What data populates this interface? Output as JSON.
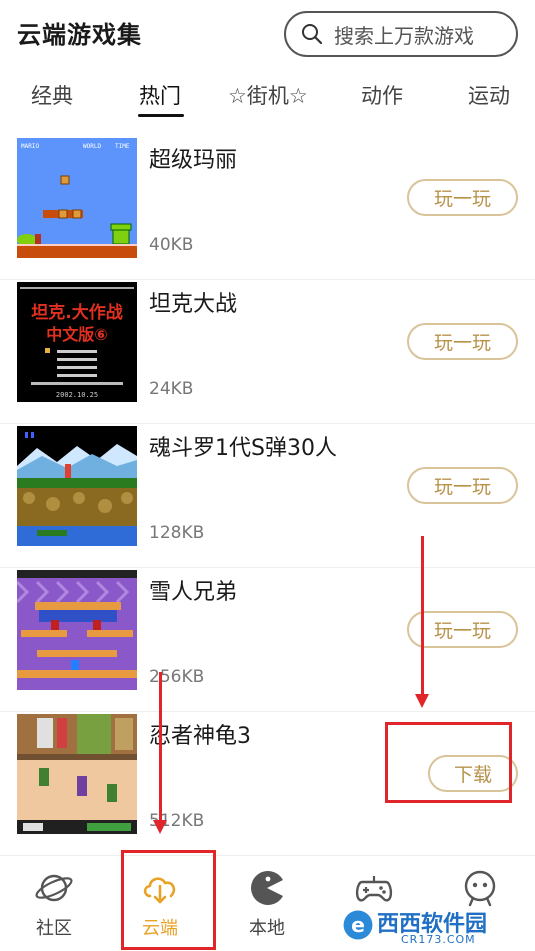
{
  "header": {
    "title": "云端游戏集",
    "search_placeholder": "搜索上万款游戏"
  },
  "tabs": [
    {
      "label": "经典",
      "active": false
    },
    {
      "label": "热门",
      "active": true
    },
    {
      "label": "☆街机☆",
      "active": false
    },
    {
      "label": "动作",
      "active": false
    },
    {
      "label": "运动",
      "active": false
    }
  ],
  "games": [
    {
      "name": "超级玛丽",
      "size": "40KB",
      "action": "玩一玩"
    },
    {
      "name": "坦克大战",
      "size": "24KB",
      "action": "玩一玩"
    },
    {
      "name": "魂斗罗1代S弹30人",
      "size": "128KB",
      "action": "玩一玩"
    },
    {
      "name": "雪人兄弟",
      "size": "256KB",
      "action": "玩一玩"
    },
    {
      "name": "忍者神龟3",
      "size": "512KB",
      "action": "下载"
    }
  ],
  "thumb_text": {
    "mario_hud": [
      "MARIO",
      "WORLD",
      "TIME"
    ],
    "tank_title": [
      "坦克.大作战",
      "中文版⑥"
    ],
    "tank_year": "2002.10.25"
  },
  "bottom_nav": [
    {
      "label": "社区",
      "icon": "planet-icon",
      "active": false
    },
    {
      "label": "云端",
      "icon": "cloud-download-icon",
      "active": true
    },
    {
      "label": "本地",
      "icon": "pacman-icon",
      "active": false
    },
    {
      "label": "",
      "icon": "gamepad-icon",
      "active": false
    },
    {
      "label": "",
      "icon": "robot-face-icon",
      "active": false
    }
  ],
  "watermark": {
    "brand": "西西软件园",
    "domain": "CR173.COM"
  },
  "colors": {
    "accent": "#e8a227",
    "button_border": "#d8c39a",
    "button_text": "#b8924a",
    "annotation_red": "#e0262b"
  }
}
